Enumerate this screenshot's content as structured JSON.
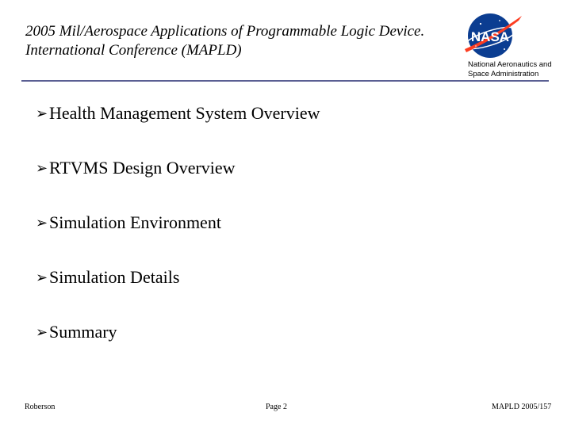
{
  "header": {
    "title_line1": "2005 Mil/Aerospace Applications of  Programmable Logic Device.",
    "title_line2": "International Conference (MAPLD)",
    "logo_text": "NASA",
    "agency_line1": "National Aeronautics and",
    "agency_line2": "Space Administration"
  },
  "bullets": [
    {
      "marker": "➢",
      "text": "Health Management System Overview"
    },
    {
      "marker": "➢",
      "text": "RTVMS Design Overview"
    },
    {
      "marker": "➢",
      "text": "Simulation Environment"
    },
    {
      "marker": "➢",
      "text": "Simulation Details"
    },
    {
      "marker": "➢",
      "text": "Summary"
    }
  ],
  "footer": {
    "author": "Roberson",
    "page": "Page 2",
    "conference": "MAPLD 2005/157"
  },
  "colors": {
    "rule": "#5a5f93",
    "nasa_blue": "#0b3d91",
    "nasa_red": "#fc3d21"
  }
}
